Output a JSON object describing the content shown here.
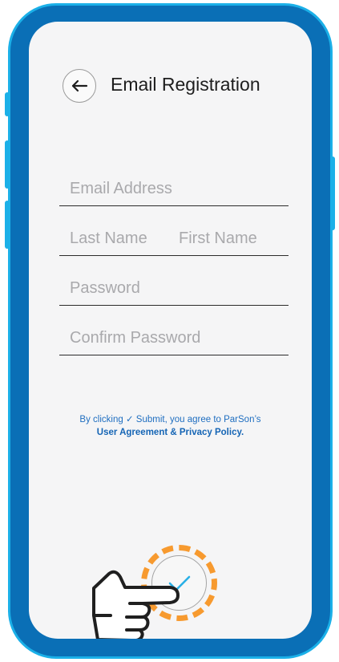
{
  "colors": {
    "frame": "#0a6fb6",
    "frame_rim": "#1bb0e8",
    "screen": "#f5f5f6",
    "accent": "#1bb0e8",
    "highlight": "#f79a2f",
    "link": "#1565b5"
  },
  "header": {
    "back_icon": "arrow-left-icon",
    "title": "Email Registration"
  },
  "form": {
    "email_placeholder": "Email Address",
    "last_name_placeholder": "Last Name",
    "first_name_placeholder": "First Name",
    "password_placeholder": "Password",
    "confirm_password_placeholder": "Confirm Password"
  },
  "agreement": {
    "prefix": "By clicking ",
    "check_symbol": "✓",
    "middle": " Submit, you agree to ParSon’s",
    "link_text": "User Agreement & Privacy Policy."
  },
  "submit": {
    "icon": "checkmark-icon",
    "highlight": "dashed-orange-circle"
  },
  "pointer": {
    "icon": "pointing-hand-icon"
  }
}
